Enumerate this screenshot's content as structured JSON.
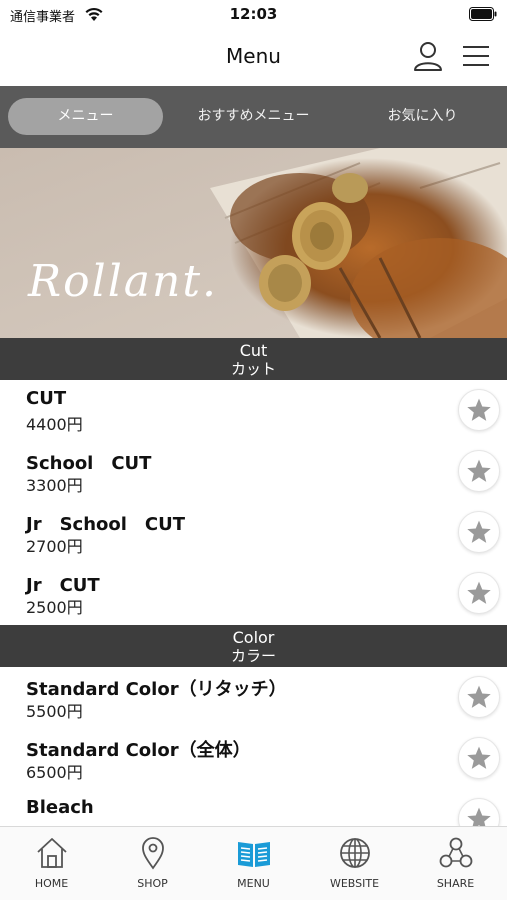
{
  "status_bar": {
    "carrier": "通信事業者",
    "time": "12:03"
  },
  "header": {
    "title": "Menu"
  },
  "tabs": [
    {
      "label": "メニュー",
      "active": true
    },
    {
      "label": "おすすめメニュー",
      "active": false
    },
    {
      "label": "お気に入り",
      "active": false
    }
  ],
  "banner": {
    "logo_text": "Rollant."
  },
  "sections": [
    {
      "title_en": "Cut",
      "title_jp": "カット",
      "items": [
        {
          "name": "CUT",
          "price": "4400円"
        },
        {
          "name": "School　CUT",
          "price": "3300円"
        },
        {
          "name": "Jr　School　CUT",
          "price": "2700円"
        },
        {
          "name": "Jr　CUT",
          "price": "2500円"
        }
      ]
    },
    {
      "title_en": "Color",
      "title_jp": "カラー",
      "items": [
        {
          "name": "Standard Color（リタッチ）",
          "price": "5500円"
        },
        {
          "name": "Standard Color（全体）",
          "price": "6500円"
        },
        {
          "name": "Bleach",
          "price": ""
        }
      ]
    }
  ],
  "bottom_nav": [
    {
      "label": "HOME",
      "icon": "home-icon"
    },
    {
      "label": "SHOP",
      "icon": "map-pin-icon"
    },
    {
      "label": "MENU",
      "icon": "book-icon",
      "active": true
    },
    {
      "label": "WEBSITE",
      "icon": "globe-icon"
    },
    {
      "label": "SHARE",
      "icon": "share-icon"
    }
  ],
  "colors": {
    "tab_bar": "#5a5a5a",
    "section_header": "#3d3d3d",
    "accent": "#1a9bd7",
    "star": "#9a9a9a"
  }
}
